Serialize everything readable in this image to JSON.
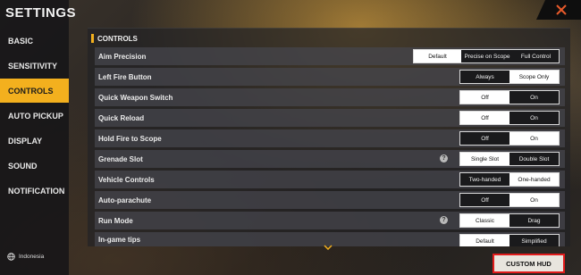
{
  "sidebar": {
    "title": "SETTINGS",
    "items": [
      {
        "label": "BASIC",
        "active": false
      },
      {
        "label": "SENSITIVITY",
        "active": false
      },
      {
        "label": "CONTROLS",
        "active": true
      },
      {
        "label": "AUTO PICKUP",
        "active": false
      },
      {
        "label": "DISPLAY",
        "active": false
      },
      {
        "label": "SOUND",
        "active": false
      },
      {
        "label": "NOTIFICATION",
        "active": false
      }
    ],
    "region": "Indonesia"
  },
  "section": {
    "title": "CONTROLS"
  },
  "rows": [
    {
      "label": "Aim Precision",
      "options": [
        "Default",
        "Precise on Scope",
        "Full Control"
      ],
      "selected": 0,
      "help": false
    },
    {
      "label": "Left Fire Button",
      "options": [
        "Always",
        "Scope Only"
      ],
      "selected": 1,
      "help": false
    },
    {
      "label": "Quick Weapon Switch",
      "options": [
        "Off",
        "On"
      ],
      "selected": 0,
      "help": false
    },
    {
      "label": "Quick Reload",
      "options": [
        "Off",
        "On"
      ],
      "selected": 0,
      "help": false
    },
    {
      "label": "Hold Fire to Scope",
      "options": [
        "Off",
        "On"
      ],
      "selected": 1,
      "help": false
    },
    {
      "label": "Grenade Slot",
      "options": [
        "Single Slot",
        "Double Slot"
      ],
      "selected": 0,
      "help": true
    },
    {
      "label": "Vehicle Controls",
      "options": [
        "Two-handed",
        "One-handed"
      ],
      "selected": 1,
      "help": false
    },
    {
      "label": "Auto-parachute",
      "options": [
        "Off",
        "On"
      ],
      "selected": 1,
      "help": false
    },
    {
      "label": "Run Mode",
      "options": [
        "Classic",
        "Drag"
      ],
      "selected": 0,
      "help": true
    },
    {
      "label": "In-game tips",
      "options": [
        "Default",
        "Simplified"
      ],
      "selected": 0,
      "help": false
    }
  ],
  "buttons": {
    "custom_hud": "CUSTOM HUD"
  },
  "icons": {
    "close": "close-icon",
    "scroll": "chevron-down-icon",
    "region": "globe-icon",
    "help": "question-icon"
  },
  "colors": {
    "accent": "#f3b01e",
    "highlight_border": "#e11b1b"
  }
}
